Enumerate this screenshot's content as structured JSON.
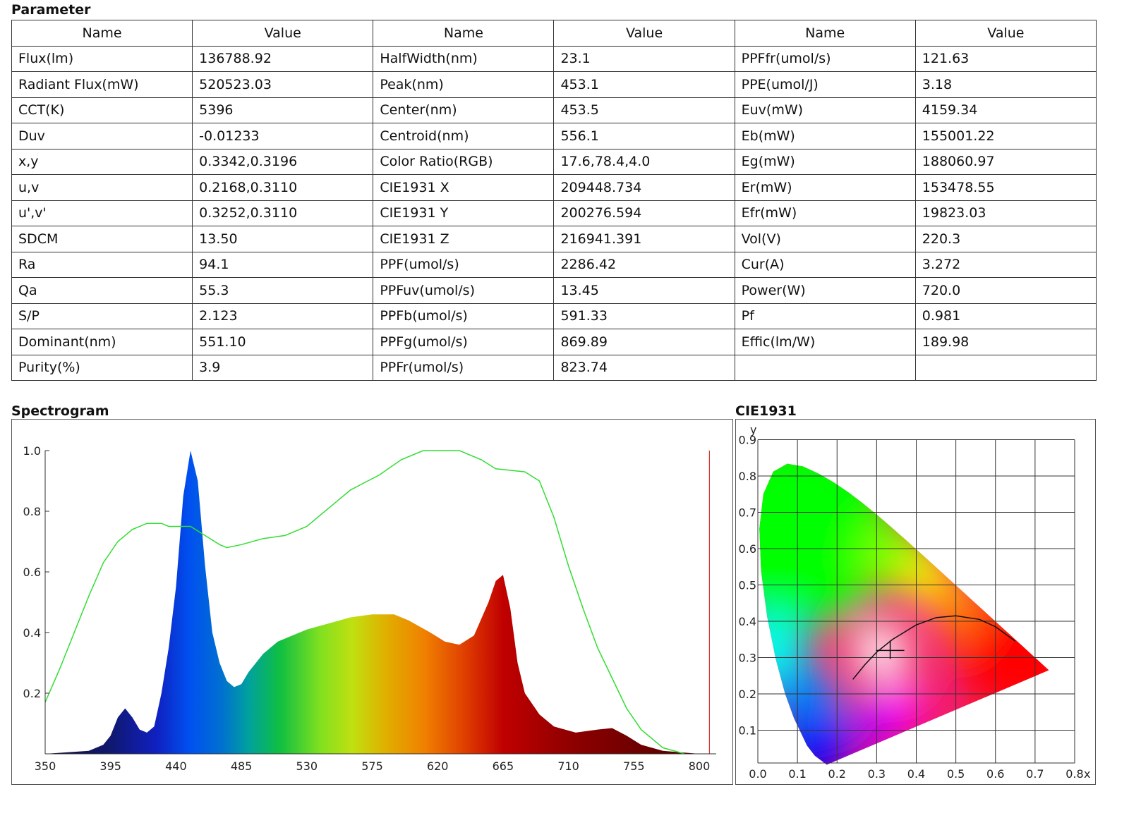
{
  "parameter": {
    "title": "Parameter",
    "headers": [
      "Name",
      "Value",
      "Name",
      "Value",
      "Name",
      "Value"
    ],
    "rows": [
      [
        "Flux(lm)",
        "136788.92",
        "HalfWidth(nm)",
        "23.1",
        "PPFfr(umol/s)",
        "121.63"
      ],
      [
        "Radiant Flux(mW)",
        "520523.03",
        "Peak(nm)",
        "453.1",
        "PPE(umol/J)",
        "3.18"
      ],
      [
        "CCT(K)",
        "5396",
        "Center(nm)",
        "453.5",
        "Euv(mW)",
        "4159.34"
      ],
      [
        "Duv",
        "-0.01233",
        "Centroid(nm)",
        "556.1",
        "Eb(mW)",
        "155001.22"
      ],
      [
        "x,y",
        "0.3342,0.3196",
        "Color Ratio(RGB)",
        "17.6,78.4,4.0",
        "Eg(mW)",
        "188060.97"
      ],
      [
        "u,v",
        "0.2168,0.3110",
        "CIE1931 X",
        "209448.734",
        "Er(mW)",
        "153478.55"
      ],
      [
        "u',v'",
        "0.3252,0.3110",
        "CIE1931 Y",
        "200276.594",
        "Efr(mW)",
        "19823.03"
      ],
      [
        "SDCM",
        "13.50",
        "CIE1931 Z",
        "216941.391",
        "Vol(V)",
        "220.3"
      ],
      [
        "Ra",
        "94.1",
        "PPF(umol/s)",
        "2286.42",
        "Cur(A)",
        "3.272"
      ],
      [
        "Qa",
        "55.3",
        "PPFuv(umol/s)",
        "13.45",
        "Power(W)",
        "720.0"
      ],
      [
        "S/P",
        "2.123",
        "PPFb(umol/s)",
        "591.33",
        "Pf",
        "0.981"
      ],
      [
        "Dominant(nm)",
        "551.10",
        "PPFg(umol/s)",
        "869.89",
        "Effic(lm/W)",
        "189.98"
      ],
      [
        "Purity(%)",
        "3.9",
        "PPFr(umol/s)",
        "823.74",
        "",
        ""
      ]
    ]
  },
  "chart_data": [
    {
      "type": "area",
      "title": "Spectrogram",
      "xlim": [
        350,
        800
      ],
      "ylim": [
        0,
        1.0
      ],
      "xticks": [
        "350",
        "395",
        "440",
        "485",
        "530",
        "575",
        "620",
        "665",
        "710",
        "755",
        "800"
      ],
      "yticks": [
        "0.2",
        "0.4",
        "0.6",
        "0.8",
        "1.0"
      ],
      "series": [
        {
          "name": "spectrum",
          "points": [
            [
              350,
              0
            ],
            [
              380,
              0.01
            ],
            [
              390,
              0.03
            ],
            [
              395,
              0.06
            ],
            [
              400,
              0.12
            ],
            [
              405,
              0.15
            ],
            [
              410,
              0.12
            ],
            [
              415,
              0.08
            ],
            [
              420,
              0.07
            ],
            [
              425,
              0.09
            ],
            [
              430,
              0.2
            ],
            [
              435,
              0.35
            ],
            [
              440,
              0.55
            ],
            [
              445,
              0.85
            ],
            [
              450,
              1.0
            ],
            [
              455,
              0.9
            ],
            [
              460,
              0.62
            ],
            [
              465,
              0.4
            ],
            [
              470,
              0.3
            ],
            [
              475,
              0.24
            ],
            [
              480,
              0.22
            ],
            [
              485,
              0.23
            ],
            [
              490,
              0.27
            ],
            [
              500,
              0.33
            ],
            [
              510,
              0.37
            ],
            [
              520,
              0.39
            ],
            [
              530,
              0.41
            ],
            [
              545,
              0.43
            ],
            [
              560,
              0.45
            ],
            [
              575,
              0.46
            ],
            [
              590,
              0.46
            ],
            [
              600,
              0.44
            ],
            [
              615,
              0.4
            ],
            [
              625,
              0.37
            ],
            [
              635,
              0.36
            ],
            [
              645,
              0.39
            ],
            [
              655,
              0.5
            ],
            [
              660,
              0.57
            ],
            [
              665,
              0.59
            ],
            [
              670,
              0.48
            ],
            [
              675,
              0.3
            ],
            [
              680,
              0.2
            ],
            [
              690,
              0.13
            ],
            [
              700,
              0.09
            ],
            [
              715,
              0.07
            ],
            [
              730,
              0.08
            ],
            [
              740,
              0.085
            ],
            [
              750,
              0.06
            ],
            [
              760,
              0.03
            ],
            [
              775,
              0.01
            ],
            [
              800,
              0
            ]
          ]
        },
        {
          "name": "reference",
          "color": "#33dd33",
          "points": [
            [
              350,
              0.17
            ],
            [
              360,
              0.28
            ],
            [
              370,
              0.4
            ],
            [
              380,
              0.52
            ],
            [
              390,
              0.63
            ],
            [
              400,
              0.7
            ],
            [
              410,
              0.74
            ],
            [
              420,
              0.76
            ],
            [
              430,
              0.76
            ],
            [
              435,
              0.75
            ],
            [
              450,
              0.75
            ],
            [
              460,
              0.72
            ],
            [
              470,
              0.69
            ],
            [
              475,
              0.68
            ],
            [
              485,
              0.69
            ],
            [
              500,
              0.71
            ],
            [
              515,
              0.72
            ],
            [
              530,
              0.75
            ],
            [
              545,
              0.81
            ],
            [
              560,
              0.87
            ],
            [
              580,
              0.92
            ],
            [
              595,
              0.97
            ],
            [
              610,
              1.0
            ],
            [
              635,
              1.0
            ],
            [
              650,
              0.97
            ],
            [
              660,
              0.94
            ],
            [
              680,
              0.93
            ],
            [
              690,
              0.9
            ],
            [
              700,
              0.78
            ],
            [
              710,
              0.62
            ],
            [
              720,
              0.48
            ],
            [
              730,
              0.35
            ],
            [
              740,
              0.25
            ],
            [
              750,
              0.15
            ],
            [
              760,
              0.08
            ],
            [
              775,
              0.02
            ],
            [
              790,
              0.0
            ]
          ]
        }
      ],
      "marker_nm": 807,
      "marker_color": "#dd3333"
    },
    {
      "type": "scatter",
      "title": "CIE1931",
      "xlabel": "x",
      "ylabel": "y",
      "xlim": [
        0,
        0.8
      ],
      "ylim": [
        0,
        0.9
      ],
      "xticks": [
        "0.0",
        "0.1",
        "0.2",
        "0.3",
        "0.4",
        "0.5",
        "0.6",
        "0.7",
        "0.8"
      ],
      "yticks": [
        "0.1",
        "0.2",
        "0.3",
        "0.4",
        "0.5",
        "0.6",
        "0.7",
        "0.8",
        "0.9"
      ],
      "point": [
        0.3342,
        0.3196
      ]
    }
  ]
}
